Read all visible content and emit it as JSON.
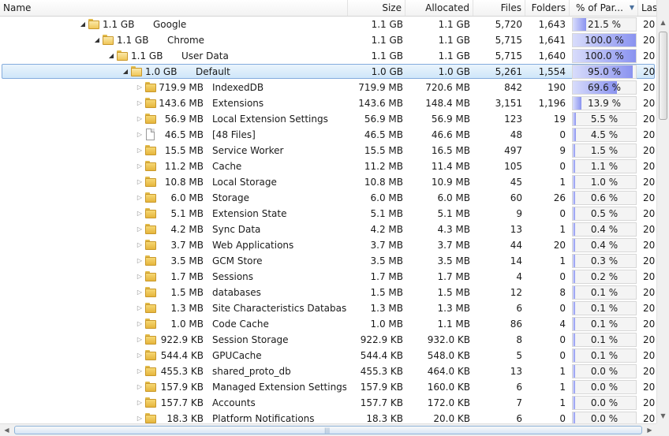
{
  "columns": {
    "name": "Name",
    "size": "Size",
    "allocated": "Allocated",
    "files": "Files",
    "folders": "Folders",
    "percent": "% of Par...",
    "last": "Last M"
  },
  "rows": [
    {
      "size_label": "1.1 GB",
      "name": "Google",
      "size": "1.1 GB",
      "allocated": "1.1 GB",
      "files": "5,720",
      "folders": "1,643",
      "percent_text": "21.5 %",
      "percent": 21.5,
      "last": "20",
      "icon": "folder-open-icon"
    },
    {
      "size_label": "1.1 GB",
      "name": "Chrome",
      "size": "1.1 GB",
      "allocated": "1.1 GB",
      "files": "5,715",
      "folders": "1,641",
      "percent_text": "100.0 %",
      "percent": 100.0,
      "last": "20",
      "icon": "folder-open-icon"
    },
    {
      "size_label": "1.1 GB",
      "name": "User Data",
      "size": "1.1 GB",
      "allocated": "1.1 GB",
      "files": "5,715",
      "folders": "1,640",
      "percent_text": "100.0 %",
      "percent": 100.0,
      "last": "20",
      "icon": "folder-open-icon"
    },
    {
      "size_label": "1.0 GB",
      "name": "Default",
      "size": "1.0 GB",
      "allocated": "1.0 GB",
      "files": "5,261",
      "folders": "1,554",
      "percent_text": "95.0 %",
      "percent": 95.0,
      "last": "20",
      "icon": "folder-open-icon"
    },
    {
      "size_label": "719.9 MB",
      "name": "IndexedDB",
      "size": "719.9 MB",
      "allocated": "720.6 MB",
      "files": "842",
      "folders": "190",
      "percent_text": "69.6 %",
      "percent": 69.6,
      "last": "20",
      "icon": "folder-icon"
    },
    {
      "size_label": "143.6 MB",
      "name": "Extensions",
      "size": "143.6 MB",
      "allocated": "148.4 MB",
      "files": "3,151",
      "folders": "1,196",
      "percent_text": "13.9 %",
      "percent": 13.9,
      "last": "20",
      "icon": "folder-icon"
    },
    {
      "size_label": "56.9 MB",
      "name": "Local Extension Settings",
      "size": "56.9 MB",
      "allocated": "56.9 MB",
      "files": "123",
      "folders": "19",
      "percent_text": "5.5 %",
      "percent": 5.5,
      "last": "20",
      "icon": "folder-icon"
    },
    {
      "size_label": "46.5 MB",
      "name": "[48 Files]",
      "size": "46.5 MB",
      "allocated": "46.6 MB",
      "files": "48",
      "folders": "0",
      "percent_text": "4.5 %",
      "percent": 4.5,
      "last": "20",
      "icon": "file-icon"
    },
    {
      "size_label": "15.5 MB",
      "name": "Service Worker",
      "size": "15.5 MB",
      "allocated": "16.5 MB",
      "files": "497",
      "folders": "9",
      "percent_text": "1.5 %",
      "percent": 1.5,
      "last": "20",
      "icon": "folder-icon"
    },
    {
      "size_label": "11.2 MB",
      "name": "Cache",
      "size": "11.2 MB",
      "allocated": "11.4 MB",
      "files": "105",
      "folders": "0",
      "percent_text": "1.1 %",
      "percent": 1.1,
      "last": "20",
      "icon": "folder-icon"
    },
    {
      "size_label": "10.8 MB",
      "name": "Local Storage",
      "size": "10.8 MB",
      "allocated": "10.9 MB",
      "files": "45",
      "folders": "1",
      "percent_text": "1.0 %",
      "percent": 1.0,
      "last": "20",
      "icon": "folder-icon"
    },
    {
      "size_label": "6.0 MB",
      "name": "Storage",
      "size": "6.0 MB",
      "allocated": "6.0 MB",
      "files": "60",
      "folders": "26",
      "percent_text": "0.6 %",
      "percent": 0.6,
      "last": "20",
      "icon": "folder-icon"
    },
    {
      "size_label": "5.1 MB",
      "name": "Extension State",
      "size": "5.1 MB",
      "allocated": "5.1 MB",
      "files": "9",
      "folders": "0",
      "percent_text": "0.5 %",
      "percent": 0.5,
      "last": "20",
      "icon": "folder-icon"
    },
    {
      "size_label": "4.2 MB",
      "name": "Sync Data",
      "size": "4.2 MB",
      "allocated": "4.3 MB",
      "files": "13",
      "folders": "1",
      "percent_text": "0.4 %",
      "percent": 0.4,
      "last": "20",
      "icon": "folder-icon"
    },
    {
      "size_label": "3.7 MB",
      "name": "Web Applications",
      "size": "3.7 MB",
      "allocated": "3.7 MB",
      "files": "44",
      "folders": "20",
      "percent_text": "0.4 %",
      "percent": 0.4,
      "last": "20",
      "icon": "folder-icon"
    },
    {
      "size_label": "3.5 MB",
      "name": "GCM Store",
      "size": "3.5 MB",
      "allocated": "3.5 MB",
      "files": "14",
      "folders": "1",
      "percent_text": "0.3 %",
      "percent": 0.3,
      "last": "20",
      "icon": "folder-icon"
    },
    {
      "size_label": "1.7 MB",
      "name": "Sessions",
      "size": "1.7 MB",
      "allocated": "1.7 MB",
      "files": "4",
      "folders": "0",
      "percent_text": "0.2 %",
      "percent": 0.2,
      "last": "20",
      "icon": "folder-icon"
    },
    {
      "size_label": "1.5 MB",
      "name": "databases",
      "size": "1.5 MB",
      "allocated": "1.5 MB",
      "files": "12",
      "folders": "8",
      "percent_text": "0.1 %",
      "percent": 0.1,
      "last": "20",
      "icon": "folder-icon"
    },
    {
      "size_label": "1.3 MB",
      "name": "Site Characteristics Database",
      "size": "1.3 MB",
      "allocated": "1.3 MB",
      "files": "6",
      "folders": "0",
      "percent_text": "0.1 %",
      "percent": 0.1,
      "last": "20",
      "icon": "folder-icon"
    },
    {
      "size_label": "1.0 MB",
      "name": "Code Cache",
      "size": "1.0 MB",
      "allocated": "1.1 MB",
      "files": "86",
      "folders": "4",
      "percent_text": "0.1 %",
      "percent": 0.1,
      "last": "20",
      "icon": "folder-icon"
    },
    {
      "size_label": "922.9 KB",
      "name": "Session Storage",
      "size": "922.9 KB",
      "allocated": "932.0 KB",
      "files": "8",
      "folders": "0",
      "percent_text": "0.1 %",
      "percent": 0.1,
      "last": "20",
      "icon": "folder-icon"
    },
    {
      "size_label": "544.4 KB",
      "name": "GPUCache",
      "size": "544.4 KB",
      "allocated": "548.0 KB",
      "files": "5",
      "folders": "0",
      "percent_text": "0.1 %",
      "percent": 0.1,
      "last": "20",
      "icon": "folder-icon"
    },
    {
      "size_label": "455.3 KB",
      "name": "shared_proto_db",
      "size": "455.3 KB",
      "allocated": "464.0 KB",
      "files": "13",
      "folders": "1",
      "percent_text": "0.0 %",
      "percent": 0.0,
      "last": "20",
      "icon": "folder-icon"
    },
    {
      "size_label": "157.9 KB",
      "name": "Managed Extension Settings",
      "size": "157.9 KB",
      "allocated": "160.0 KB",
      "files": "6",
      "folders": "1",
      "percent_text": "0.0 %",
      "percent": 0.0,
      "last": "20",
      "icon": "folder-icon"
    },
    {
      "size_label": "157.7 KB",
      "name": "Accounts",
      "size": "157.7 KB",
      "allocated": "172.0 KB",
      "files": "7",
      "folders": "1",
      "percent_text": "0.0 %",
      "percent": 0.0,
      "last": "20",
      "icon": "folder-icon"
    },
    {
      "size_label": "18.3 KB",
      "name": "Platform Notifications",
      "size": "18.3 KB",
      "allocated": "20.0 KB",
      "files": "6",
      "folders": "0",
      "percent_text": "0.0 %",
      "percent": 0.0,
      "last": "20",
      "icon": "folder-icon"
    }
  ],
  "selected_row": "Default",
  "colors": {
    "selection_border": "#84acdd",
    "bar_fill": "#8a93f0",
    "folder": "#f6d874"
  }
}
